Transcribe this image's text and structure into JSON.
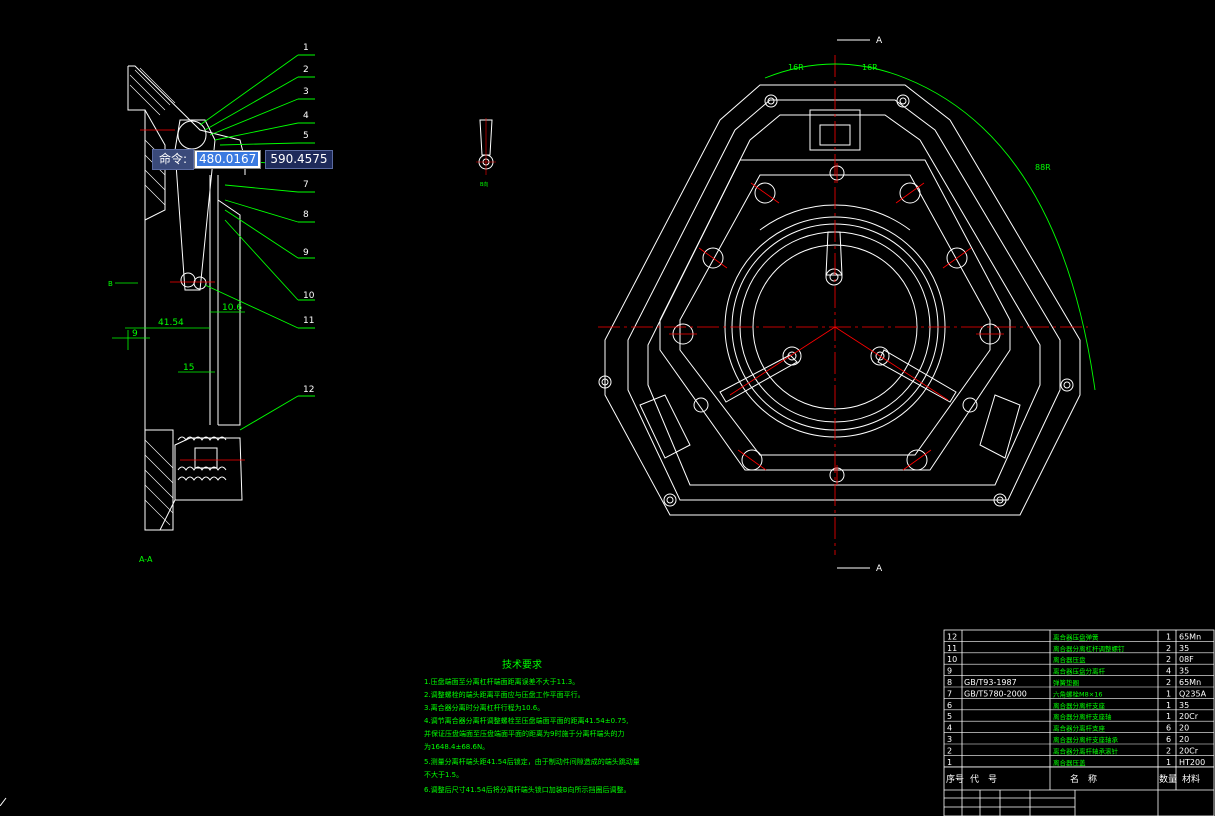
{
  "command_bar": {
    "prompt": "命令:",
    "x_value": "480.0167",
    "y_value": "590.4575"
  },
  "side_view": {
    "callouts": [
      "1",
      "2",
      "3",
      "4",
      "5",
      "6",
      "7",
      "8",
      "9",
      "10",
      "11",
      "12"
    ],
    "section_label": "A-A",
    "view_marker": "B",
    "dims": {
      "d1": "41.54",
      "d2": "9",
      "d3": "10.6",
      "d4": "15"
    }
  },
  "detail_view": {
    "label": "B向"
  },
  "front_view": {
    "section_marker": "A",
    "dims": {
      "a": "16R",
      "b": "16R",
      "c": "88R"
    }
  },
  "tech_requirements": {
    "title": "技术要求",
    "lines": [
      "1.压盘端面至分离杠杆端面距离误差不大于11.3。",
      "2.调整螺栓的端头距离平面应与压盘工作平面平行。",
      "3.离合器分离时分离杠杆行程为10.6。",
      "4.调节离合器分离杆调整螺栓至压盘端面平面的距离41.54±0.75,",
      "  并保证压盘端面至压盘端面平面的距离为9时施于分离杆端头的力",
      "  为1648.4±68.6N。",
      "5.测量分离杆端头距41.54后锁定，由于制动件间隙造成的端头跳动量",
      "  不大于1.5。",
      "6.调整后尺寸41.54后将分离杆端头锁口加装B向所示挡圈后调整。"
    ]
  },
  "parts_table": {
    "rows": [
      {
        "no": "12",
        "code": "",
        "name": "离合器压盘弹簧",
        "qty": "1",
        "material": "65Mn"
      },
      {
        "no": "11",
        "code": "",
        "name": "离合器分离杠杆调整螺钉",
        "qty": "2",
        "material": "35"
      },
      {
        "no": "10",
        "code": "",
        "name": "离合器压盘",
        "qty": "2",
        "material": "08F"
      },
      {
        "no": "9",
        "code": "",
        "name": "离合器压盘分离杆",
        "qty": "4",
        "material": "35"
      },
      {
        "no": "8",
        "code": "GB/T93-1987",
        "name": "弹簧垫圈",
        "qty": "2",
        "material": "65Mn"
      },
      {
        "no": "7",
        "code": "GB/T5780-2000",
        "name": "六角螺栓M8×16",
        "qty": "1",
        "material": "Q235A"
      },
      {
        "no": "6",
        "code": "",
        "name": "离合器分离杆支座",
        "qty": "1",
        "material": "35"
      },
      {
        "no": "5",
        "code": "",
        "name": "离合器分离杆支座轴",
        "qty": "1",
        "material": "20Cr"
      },
      {
        "no": "4",
        "code": "",
        "name": "离合器分离杆支座",
        "qty": "6",
        "material": "20"
      },
      {
        "no": "3",
        "code": "",
        "name": "离合器分离杆支座轴承",
        "qty": "6",
        "material": "20"
      },
      {
        "no": "2",
        "code": "",
        "name": "离合器分离杆轴承滚针",
        "qty": "2",
        "material": "20Cr"
      },
      {
        "no": "1",
        "code": "",
        "name": "离合器压盖",
        "qty": "1",
        "material": "HT200"
      }
    ],
    "header": {
      "no": "序号",
      "code": "代　号",
      "name": "名　称",
      "qty": "数量",
      "material": "材料"
    }
  }
}
